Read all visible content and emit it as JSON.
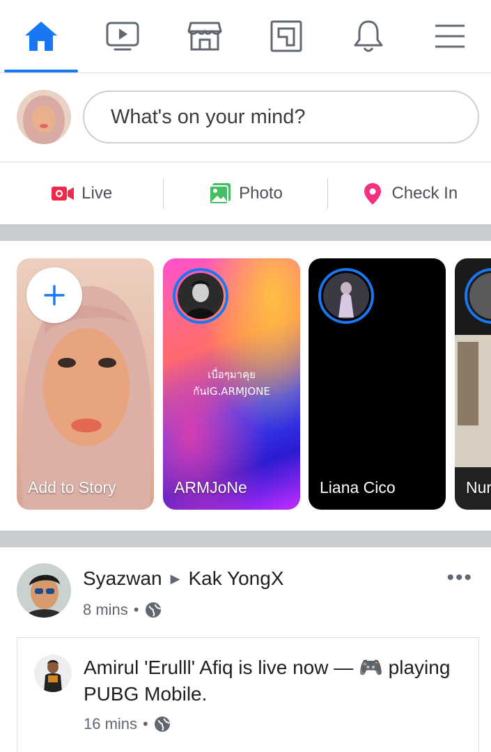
{
  "colors": {
    "accent": "#1877f2",
    "live_red": "#f02849",
    "photo_green": "#45bd62",
    "checkin_pink": "#f5317f",
    "divider": "#c9ccd1",
    "icon_gray": "#606770"
  },
  "topnav": {
    "tabs": [
      {
        "icon": "home-icon",
        "active": true
      },
      {
        "icon": "watch-icon",
        "active": false
      },
      {
        "icon": "marketplace-icon",
        "active": false
      },
      {
        "icon": "gaming-icon",
        "active": false
      },
      {
        "icon": "bell-icon",
        "active": false
      },
      {
        "icon": "menu-icon",
        "active": false
      }
    ]
  },
  "composer": {
    "placeholder": "What's on your mind?"
  },
  "actions": {
    "live": "Live",
    "photo": "Photo",
    "checkin": "Check In"
  },
  "stories": {
    "items": [
      {
        "name": "Add to Story"
      },
      {
        "name": "ARMJoNe",
        "text_line1": "เบื่อๆมาคุย",
        "text_line2": "กันIG.ARMJONE"
      },
      {
        "name": "Liana Cico"
      },
      {
        "name": "Nuru"
      }
    ]
  },
  "post": {
    "author": "Syazwan",
    "target": "Kak YongX",
    "time": "8 mins",
    "more": "•••",
    "shared": {
      "text": "Amirul 'Erulll' Afiq is live now — 🎮 playing PUBG Mobile.",
      "time": "16 mins"
    }
  }
}
